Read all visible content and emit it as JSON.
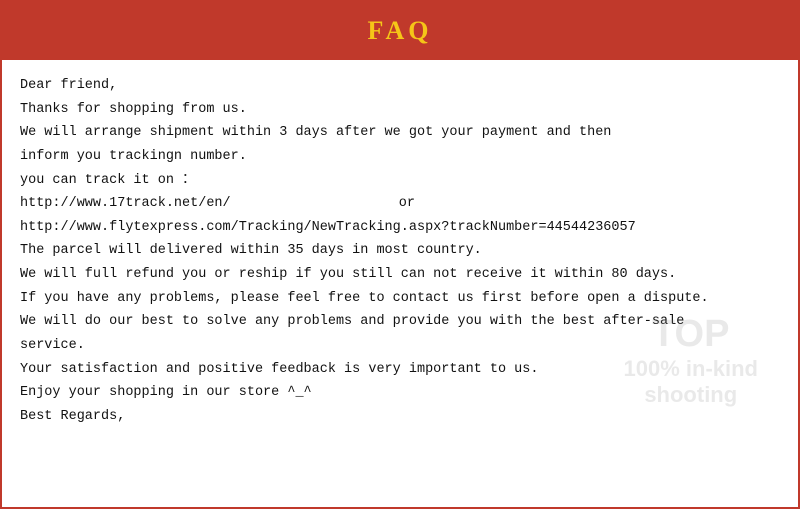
{
  "header": {
    "title": "FAQ"
  },
  "content": {
    "line1": "Dear friend,",
    "line2": "Thanks for shopping from us.",
    "line3": "We will arrange shipment within 3 days after we got your payment and then",
    "line4": "inform you trackingn number.",
    "line5": "you can track it on ：",
    "line6": "http://www.17track.net/en/",
    "line6_or": "or",
    "line7": "http://www.flytexpress.com/Tracking/NewTracking.aspx?trackNumber=44544236057",
    "line8": "The parcel will delivered within 35 days in most country.",
    "line9": "We will full refund you or reship if you still can not receive it within 80 days.",
    "line10": "If you have any problems, please feel free to contact us first before open a dispute.",
    "line11": "We will do our best to solve any problems and provide you with the best after-sale",
    "line12": "service.",
    "line13": "Your satisfaction and positive feedback is very important to us.",
    "line14": "Enjoy your shopping in our store ^_^",
    "line15": "Best Regards,",
    "watermark_top": "TOP",
    "watermark_bottom": "100% in-kind\n  shooting"
  }
}
